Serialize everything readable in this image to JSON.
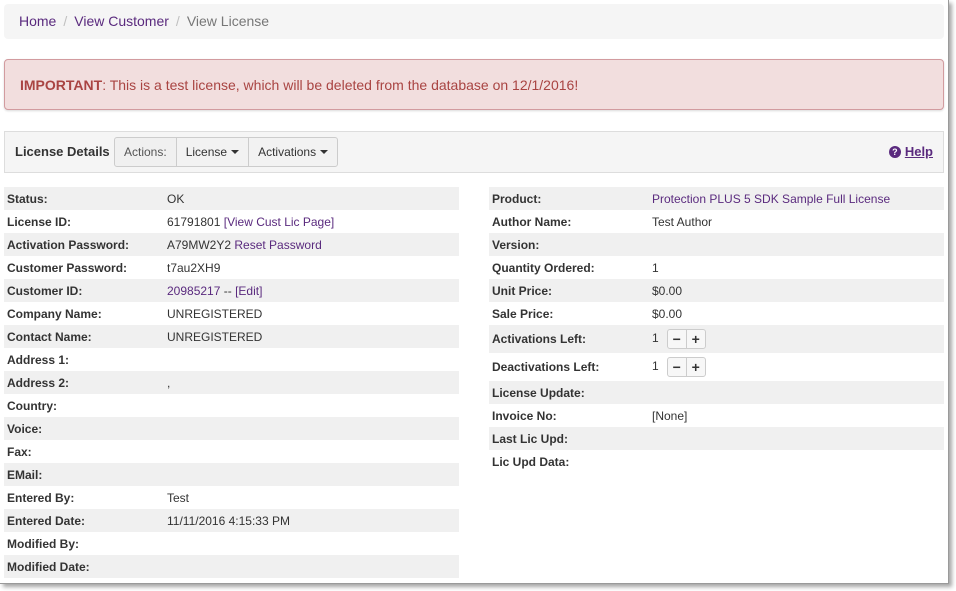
{
  "breadcrumb": {
    "home": "Home",
    "view_customer": "View Customer",
    "current": "View License",
    "sep": "/"
  },
  "alert": {
    "label": "IMPORTANT",
    "message": ": This is a test license, which will be deleted from the database on 12/1/2016!"
  },
  "toolbar": {
    "title": "License Details",
    "actions_label": "Actions:",
    "license_label": "License",
    "activations_label": "Activations",
    "help_label": "Help"
  },
  "left": [
    {
      "label": "Status:",
      "value": "OK"
    },
    {
      "label": "License ID:",
      "value": "61791801",
      "link": "[View Cust Lic Page]"
    },
    {
      "label": "Activation Password:",
      "value": "A79MW2Y2",
      "link": "Reset Password"
    },
    {
      "label": "Customer Password:",
      "value": "t7au2XH9"
    },
    {
      "label": "Customer ID:",
      "value_link": "20985217",
      "value": " -- ",
      "link": "[Edit]"
    },
    {
      "label": "Company Name:",
      "value": "UNREGISTERED"
    },
    {
      "label": "Contact Name:",
      "value": "UNREGISTERED"
    },
    {
      "label": "Address 1:",
      "value": ""
    },
    {
      "label": "Address 2:",
      "value": ","
    },
    {
      "label": "Country:",
      "value": ""
    },
    {
      "label": "Voice:",
      "value": ""
    },
    {
      "label": "Fax:",
      "value": ""
    },
    {
      "label": "EMail:",
      "value": ""
    },
    {
      "label": "Entered By:",
      "value": "Test"
    },
    {
      "label": "Entered Date:",
      "value": "11/11/2016 4:15:33 PM"
    },
    {
      "label": "Modified By:",
      "value": ""
    },
    {
      "label": "Modified Date:",
      "value": ""
    }
  ],
  "right": [
    {
      "label": "Product:",
      "value_link": "Protection PLUS 5 SDK Sample Full License"
    },
    {
      "label": "Author Name:",
      "value": "Test Author"
    },
    {
      "label": "Version:",
      "value": ""
    },
    {
      "label": "Quantity Ordered:",
      "value": "1"
    },
    {
      "label": "Unit Price:",
      "value": "$0.00"
    },
    {
      "label": "Sale Price:",
      "value": "$0.00"
    },
    {
      "label": "Activations Left:",
      "value": "1",
      "stepper": true
    },
    {
      "label": "Deactivations Left:",
      "value": "1",
      "stepper": true
    },
    {
      "label": "License Update:",
      "value": ""
    },
    {
      "label": "Invoice No:",
      "value": "[None]"
    },
    {
      "label": "Last Lic Upd:",
      "value": ""
    },
    {
      "label": "Lic Upd Data:",
      "value": ""
    }
  ],
  "stepper": {
    "minus": "−",
    "plus": "+"
  },
  "colors": {
    "link": "#5a2a7e",
    "alert_text": "#a94442",
    "alert_bg": "#f2dede"
  }
}
